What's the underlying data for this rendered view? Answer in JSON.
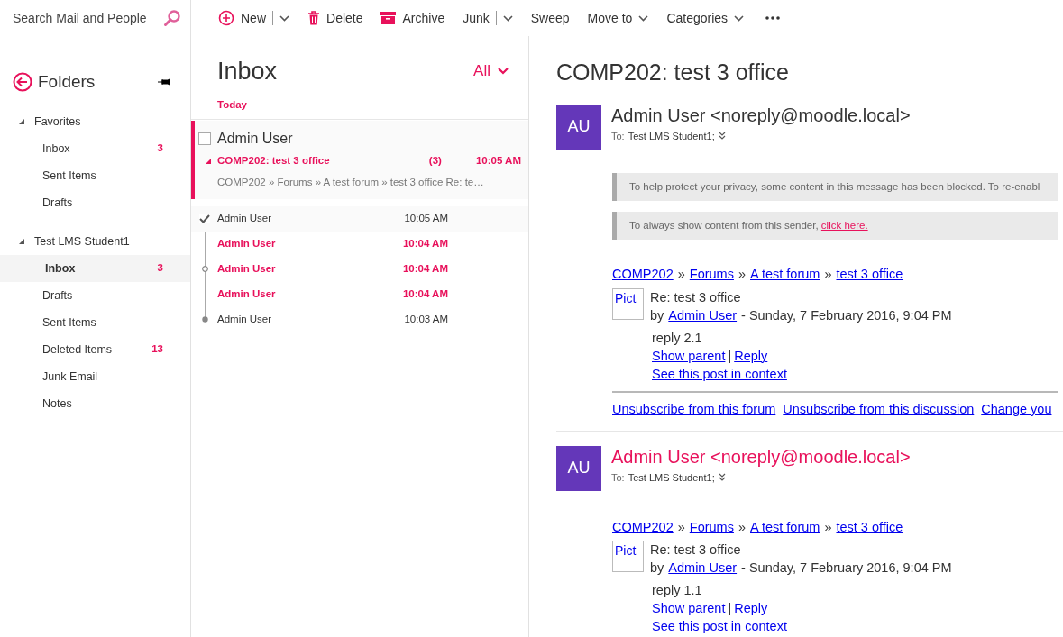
{
  "search": {
    "placeholder": "Search Mail and People"
  },
  "toolbar": [
    {
      "kind": "split",
      "label": "New"
    },
    {
      "kind": "button",
      "label": "Delete"
    },
    {
      "kind": "button",
      "label": "Archive"
    },
    {
      "kind": "split",
      "label": "Junk"
    },
    {
      "kind": "button",
      "label": "Sweep"
    },
    {
      "kind": "menu",
      "label": "Move to"
    },
    {
      "kind": "menu",
      "label": "Categories"
    },
    {
      "kind": "more"
    }
  ],
  "folders": {
    "title": "Folders",
    "groups": [
      {
        "name": "Favorites",
        "expanded": true,
        "children": [
          {
            "label": "Inbox",
            "count": "3",
            "selected": false
          },
          {
            "label": "Sent Items",
            "selected": false
          },
          {
            "label": "Drafts",
            "selected": false
          }
        ]
      },
      {
        "name": "Test LMS Student1",
        "expanded": true,
        "children": [
          {
            "label": "Inbox",
            "count": "3",
            "selected": true
          },
          {
            "label": "Drafts",
            "selected": false
          },
          {
            "label": "Sent Items",
            "selected": false
          },
          {
            "label": "Deleted Items",
            "count": "13",
            "selected": false
          },
          {
            "label": "Junk Email",
            "selected": false
          },
          {
            "label": "Notes",
            "selected": false
          }
        ]
      }
    ]
  },
  "message_list": {
    "title": "Inbox",
    "filter": "All",
    "section": "Today",
    "conversations": [
      {
        "sender": "Admin User",
        "subject": "COMP202: test 3 office",
        "count": "(3)",
        "time": "10:05 AM",
        "preview": "COMP202 » Forums » A test forum » test 3 office  Re: te…",
        "selected": true,
        "expanded": true,
        "checked": false,
        "items": [
          {
            "kind": "current",
            "sender": "Admin User",
            "time": "10:05 AM",
            "unread": false,
            "selected": true
          },
          {
            "kind": "plain",
            "sender": "Admin User",
            "time": "10:04 AM",
            "unread": true,
            "selected": false
          },
          {
            "kind": "branch",
            "sender": "Admin User",
            "time": "10:04 AM",
            "unread": true,
            "selected": false
          },
          {
            "kind": "plain",
            "sender": "Admin User",
            "time": "10:04 AM",
            "unread": true,
            "selected": false
          },
          {
            "kind": "first",
            "sender": "Admin User",
            "time": "10:03 AM",
            "unread": false,
            "selected": false
          }
        ]
      }
    ]
  },
  "reading": {
    "subject": "COMP202: test 3 office",
    "messages": [
      {
        "avatar": "AU",
        "from": "Admin User <noreply@moodle.local>",
        "unread": false,
        "to_label": "To:",
        "to": "Test LMS Student1;",
        "notices": [
          {
            "text": "To help protect your privacy, some content in this message has been blocked. To re-enabl"
          },
          {
            "text": "To always show content from this sender,",
            "link": "click here."
          }
        ],
        "breadcrumb": [
          {
            "kind": "link",
            "text": "COMP202"
          },
          {
            "kind": "sep",
            "text": "»"
          },
          {
            "kind": "link",
            "text": "Forums"
          },
          {
            "kind": "sep",
            "text": "»"
          },
          {
            "kind": "link",
            "text": "A test forum"
          },
          {
            "kind": "sep",
            "text": "»"
          },
          {
            "kind": "link",
            "text": "test 3 office"
          }
        ],
        "picture": "Pict",
        "title": "Re: test 3 office",
        "by": "by",
        "author": "Admin User",
        "date": "- Sunday, 7 February 2016, 9:04 PM",
        "body": "reply 2.1",
        "actions": [
          {
            "kind": "link",
            "text": "Show parent"
          },
          {
            "kind": "sep",
            "text": "|"
          },
          {
            "kind": "link",
            "text": "Reply"
          }
        ],
        "context_link": "See this post in context",
        "footer_links": [
          "Unsubscribe from this forum",
          "Unsubscribe from this discussion",
          "Change you"
        ]
      },
      {
        "avatar": "AU",
        "from": "Admin User <noreply@moodle.local>",
        "unread": true,
        "to_label": "To:",
        "to": "Test LMS Student1;",
        "breadcrumb": [
          {
            "kind": "link",
            "text": "COMP202"
          },
          {
            "kind": "sep",
            "text": "»"
          },
          {
            "kind": "link",
            "text": "Forums"
          },
          {
            "kind": "sep",
            "text": "»"
          },
          {
            "kind": "link",
            "text": "A test forum"
          },
          {
            "kind": "sep",
            "text": "»"
          },
          {
            "kind": "link",
            "text": "test 3 office"
          }
        ],
        "picture": "Pict",
        "title": "Re: test 3 office",
        "by": "by",
        "author": "Admin User",
        "date": "- Sunday, 7 February 2016, 9:04 PM",
        "body": "reply 1.1",
        "actions": [
          {
            "kind": "link",
            "text": "Show parent"
          },
          {
            "kind": "sep",
            "text": "|"
          },
          {
            "kind": "link",
            "text": "Reply"
          }
        ],
        "context_link": "See this post in context"
      }
    ]
  }
}
